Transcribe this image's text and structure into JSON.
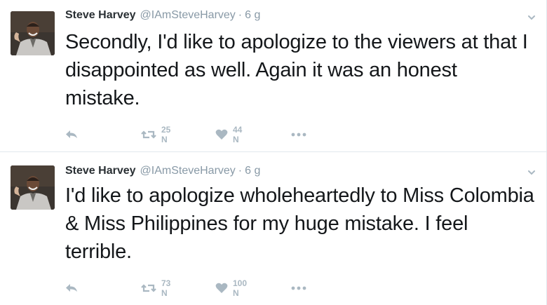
{
  "tweets": [
    {
      "author": {
        "name": "Steve Harvey",
        "handle": "@IAmSteveHarvey"
      },
      "separator": "·",
      "time": "6 g",
      "text": "Secondly, I'd like to apologize to the viewers at that I disappointed as well. Again it was an honest mistake.",
      "retweets": "25 N",
      "likes": "44 N"
    },
    {
      "author": {
        "name": "Steve Harvey",
        "handle": "@IAmSteveHarvey"
      },
      "separator": "·",
      "time": "6 g",
      "text": "I'd like to apologize wholeheartedly to Miss Colombia & Miss Philippines for my huge mistake. I feel terrible.",
      "retweets": "73 N",
      "likes": "100 N"
    }
  ],
  "icons": {
    "reply": "reply-icon",
    "retweet": "retweet-icon",
    "like": "heart-icon",
    "more": "more-dots-icon",
    "caret": "chevron-down-icon"
  },
  "colors": {
    "text": "#14171a",
    "muted": "#8899a6",
    "icon": "#aab8c2",
    "border": "#e1e8ed"
  }
}
